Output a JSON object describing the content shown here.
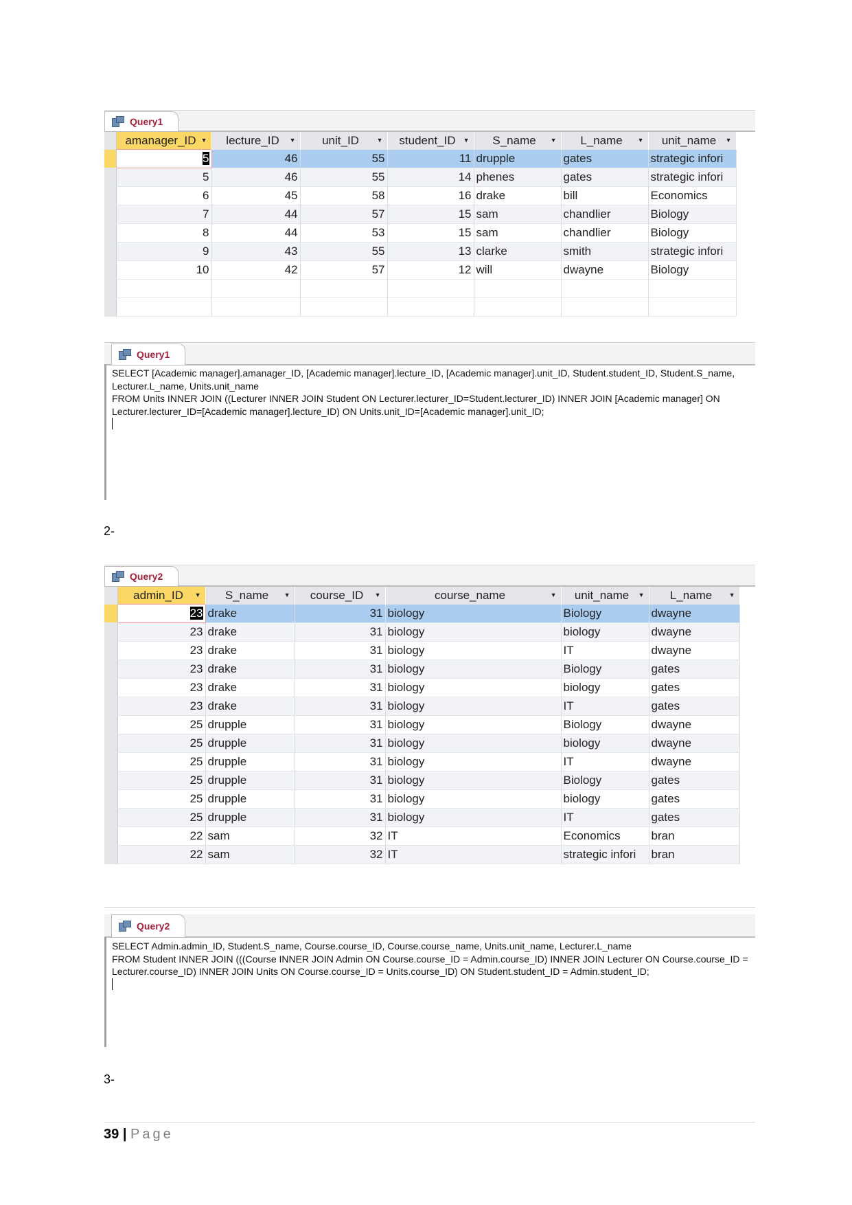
{
  "query1": {
    "tab": "Query1",
    "columns": [
      "amanager_ID",
      "lecture_ID",
      "unit_ID",
      "student_ID",
      "S_name",
      "L_name",
      "unit_name"
    ],
    "numeric": [
      true,
      true,
      true,
      true,
      false,
      false,
      false
    ],
    "rows": [
      [
        "5",
        "46",
        "55",
        "11",
        "drupple",
        "gates",
        "strategic infori"
      ],
      [
        "5",
        "46",
        "55",
        "14",
        "phenes",
        "gates",
        "strategic infori"
      ],
      [
        "6",
        "45",
        "58",
        "16",
        "drake",
        "bill",
        "Economics"
      ],
      [
        "7",
        "44",
        "57",
        "15",
        "sam",
        "chandlier",
        "Biology"
      ],
      [
        "8",
        "44",
        "53",
        "15",
        "sam",
        "chandlier",
        "Biology"
      ],
      [
        "9",
        "43",
        "55",
        "13",
        "clarke",
        "smith",
        "strategic infori"
      ],
      [
        "10",
        "42",
        "57",
        "12",
        "will",
        "dwayne",
        "Biology"
      ]
    ],
    "sql_tab": "Query1",
    "sql": "SELECT [Academic manager].amanager_ID, [Academic manager].lecture_ID, [Academic manager].unit_ID, Student.student_ID, Student.S_name, Lecturer.L_name, Units.unit_name\nFROM Units INNER JOIN ((Lecturer INNER JOIN Student ON Lecturer.lecturer_ID=Student.lecturer_ID) INNER JOIN [Academic manager] ON Lecturer.lecturer_ID=[Academic manager].lecture_ID) ON Units.unit_ID=[Academic manager].unit_ID;"
  },
  "label2": "2-",
  "query2": {
    "tab": "Query2",
    "columns": [
      "admin_ID",
      "S_name",
      "course_ID",
      "course_name",
      "unit_name",
      "L_name"
    ],
    "numeric": [
      true,
      false,
      true,
      false,
      false,
      false
    ],
    "rows": [
      [
        "23",
        "drake",
        "31",
        "biology",
        "Biology",
        "dwayne"
      ],
      [
        "23",
        "drake",
        "31",
        "biology",
        "biology",
        "dwayne"
      ],
      [
        "23",
        "drake",
        "31",
        "biology",
        "IT",
        "dwayne"
      ],
      [
        "23",
        "drake",
        "31",
        "biology",
        "Biology",
        "gates"
      ],
      [
        "23",
        "drake",
        "31",
        "biology",
        "biology",
        "gates"
      ],
      [
        "23",
        "drake",
        "31",
        "biology",
        "IT",
        "gates"
      ],
      [
        "25",
        "drupple",
        "31",
        "biology",
        "Biology",
        "dwayne"
      ],
      [
        "25",
        "drupple",
        "31",
        "biology",
        "biology",
        "dwayne"
      ],
      [
        "25",
        "drupple",
        "31",
        "biology",
        "IT",
        "dwayne"
      ],
      [
        "25",
        "drupple",
        "31",
        "biology",
        "Biology",
        "gates"
      ],
      [
        "25",
        "drupple",
        "31",
        "biology",
        "biology",
        "gates"
      ],
      [
        "25",
        "drupple",
        "31",
        "biology",
        "IT",
        "gates"
      ],
      [
        "22",
        "sam",
        "32",
        "IT",
        "Economics",
        "bran"
      ],
      [
        "22",
        "sam",
        "32",
        "IT",
        "strategic infori",
        "bran"
      ]
    ],
    "sql_tab": "Query2",
    "sql": "SELECT Admin.admin_ID, Student.S_name, Course.course_ID, Course.course_name, Units.unit_name, Lecturer.L_name\nFROM Student INNER JOIN (((Course INNER JOIN Admin ON Course.course_ID = Admin.course_ID) INNER JOIN Lecturer ON Course.course_ID = Lecturer.course_ID) INNER JOIN Units ON Course.course_ID = Units.course_ID) ON Student.student_ID = Admin.student_ID;"
  },
  "label3": "3-",
  "footer": {
    "page_number": "39",
    "separator": "|",
    "page_word": "Page"
  },
  "colors": {
    "tab_text": "#a5213b",
    "selected_row": "#a9ccef",
    "selected_header": "#fbd866"
  }
}
